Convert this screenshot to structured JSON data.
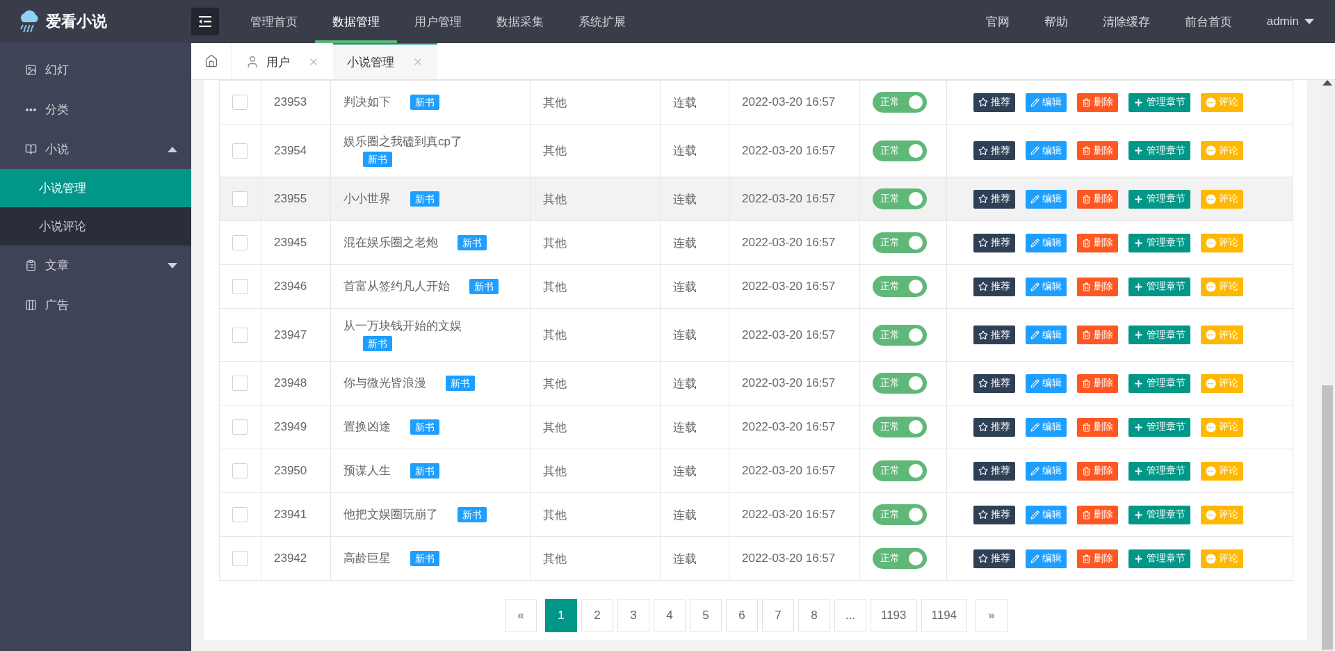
{
  "header": {
    "logo": "爱看小说",
    "nav": [
      {
        "label": "管理首页",
        "selected": false
      },
      {
        "label": "数据管理",
        "selected": true
      },
      {
        "label": "用户管理",
        "selected": false
      },
      {
        "label": "数据采集",
        "selected": false
      },
      {
        "label": "系统扩展",
        "selected": false
      }
    ],
    "links": [
      "官网",
      "帮助",
      "清除缓存",
      "前台首页"
    ],
    "user": "admin"
  },
  "sidebar": {
    "items": [
      {
        "label": "幻灯"
      },
      {
        "label": "分类"
      },
      {
        "label": "小说",
        "expanded": true,
        "children": [
          {
            "label": "小说管理",
            "selected": true
          },
          {
            "label": "小说评论",
            "selected": false
          }
        ]
      },
      {
        "label": "文章",
        "expanded": false
      },
      {
        "label": "广告"
      }
    ]
  },
  "tabs": [
    {
      "label": "用户",
      "selected": false
    },
    {
      "label": "小说管理",
      "selected": true
    }
  ],
  "table": {
    "rows": [
      {
        "checked": false,
        "hovered": false,
        "id": "23953",
        "title": "判决如下",
        "tag": "新书",
        "category": "其他",
        "status": "连载",
        "date": "2022-03-20 16:57",
        "switch": {
          "label": "正常",
          "on": true
        },
        "actions": [
          "推荐",
          "编辑",
          "删除",
          "管理章节",
          "评论"
        ]
      },
      {
        "checked": false,
        "hovered": false,
        "id": "23954",
        "title": "娱乐圈之我磕到真cp了",
        "tag": "新书",
        "category": "其他",
        "status": "连载",
        "date": "2022-03-20 16:57",
        "switch": {
          "label": "正常",
          "on": true
        },
        "actions": [
          "推荐",
          "编辑",
          "删除",
          "管理章节",
          "评论"
        ]
      },
      {
        "checked": false,
        "hovered": true,
        "id": "23955",
        "title": "小小世界",
        "tag": "新书",
        "category": "其他",
        "status": "连载",
        "date": "2022-03-20 16:57",
        "switch": {
          "label": "正常",
          "on": true
        },
        "actions": [
          "推荐",
          "编辑",
          "删除",
          "管理章节",
          "评论"
        ]
      },
      {
        "checked": false,
        "hovered": false,
        "id": "23945",
        "title": "混在娱乐圈之老炮",
        "tag": "新书",
        "category": "其他",
        "status": "连载",
        "date": "2022-03-20 16:57",
        "switch": {
          "label": "正常",
          "on": true
        },
        "actions": [
          "推荐",
          "编辑",
          "删除",
          "管理章节",
          "评论"
        ]
      },
      {
        "checked": false,
        "hovered": false,
        "id": "23946",
        "title": "首富从签约凡人开始",
        "tag": "新书",
        "category": "其他",
        "status": "连载",
        "date": "2022-03-20 16:57",
        "switch": {
          "label": "正常",
          "on": true
        },
        "actions": [
          "推荐",
          "编辑",
          "删除",
          "管理章节",
          "评论"
        ]
      },
      {
        "checked": false,
        "hovered": false,
        "id": "23947",
        "title": "从一万块钱开始的文娱",
        "tag": "新书",
        "category": "其他",
        "status": "连载",
        "date": "2022-03-20 16:57",
        "switch": {
          "label": "正常",
          "on": true
        },
        "actions": [
          "推荐",
          "编辑",
          "删除",
          "管理章节",
          "评论"
        ]
      },
      {
        "checked": false,
        "hovered": false,
        "id": "23948",
        "title": "你与微光皆浪漫",
        "tag": "新书",
        "category": "其他",
        "status": "连载",
        "date": "2022-03-20 16:57",
        "switch": {
          "label": "正常",
          "on": true
        },
        "actions": [
          "推荐",
          "编辑",
          "删除",
          "管理章节",
          "评论"
        ]
      },
      {
        "checked": false,
        "hovered": false,
        "id": "23949",
        "title": "置换凶途",
        "tag": "新书",
        "category": "其他",
        "status": "连载",
        "date": "2022-03-20 16:57",
        "switch": {
          "label": "正常",
          "on": true
        },
        "actions": [
          "推荐",
          "编辑",
          "删除",
          "管理章节",
          "评论"
        ]
      },
      {
        "checked": false,
        "hovered": false,
        "id": "23950",
        "title": "预谋人生",
        "tag": "新书",
        "category": "其他",
        "status": "连载",
        "date": "2022-03-20 16:57",
        "switch": {
          "label": "正常",
          "on": true
        },
        "actions": [
          "推荐",
          "编辑",
          "删除",
          "管理章节",
          "评论"
        ]
      },
      {
        "checked": false,
        "hovered": false,
        "id": "23941",
        "title": "他把文娱圈玩崩了",
        "tag": "新书",
        "category": "其他",
        "status": "连载",
        "date": "2022-03-20 16:57",
        "switch": {
          "label": "正常",
          "on": true
        },
        "actions": [
          "推荐",
          "编辑",
          "删除",
          "管理章节",
          "评论"
        ]
      },
      {
        "checked": false,
        "hovered": false,
        "id": "23942",
        "title": "高龄巨星",
        "tag": "新书",
        "category": "其他",
        "status": "连载",
        "date": "2022-03-20 16:57",
        "switch": {
          "label": "正常",
          "on": true
        },
        "actions": [
          "推荐",
          "编辑",
          "删除",
          "管理章节",
          "评论"
        ]
      }
    ]
  },
  "pagination": {
    "prev": "«",
    "next": "»",
    "pages": [
      {
        "label": "1",
        "selected": true
      },
      {
        "label": "2",
        "selected": false
      },
      {
        "label": "3",
        "selected": false
      },
      {
        "label": "4",
        "selected": false
      },
      {
        "label": "5",
        "selected": false
      },
      {
        "label": "6",
        "selected": false
      },
      {
        "label": "7",
        "selected": false
      },
      {
        "label": "8",
        "selected": false
      },
      {
        "label": "...",
        "selected": false
      },
      {
        "label": "1193",
        "selected": false
      },
      {
        "label": "1194",
        "selected": false
      }
    ]
  }
}
